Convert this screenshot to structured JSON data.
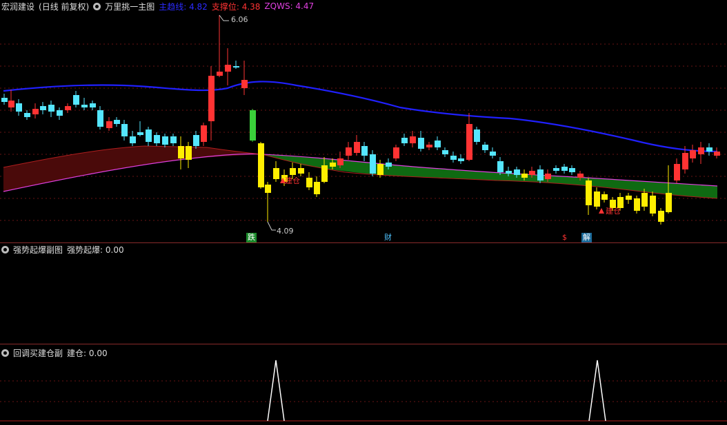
{
  "main_panel": {
    "stock_name": "宏润建设",
    "period_label": "(日线 前复权)",
    "indicator_name": "万里挑一主图",
    "line1": {
      "label": "主趋线",
      "value": "4.82",
      "color": "#2b2bff"
    },
    "line2": {
      "label": "支撑位",
      "value": "4.38",
      "color": "#ff3333"
    },
    "line3": {
      "label": "ZQWS",
      "value": "4.47",
      "color": "#e040e0"
    },
    "high_label": "6.06",
    "low_label": "4.09",
    "markers": [
      {
        "text": "跌",
        "color": "#ffffff",
        "bg": "#1b8a2b"
      },
      {
        "text": "财",
        "color": "#4fc3ff",
        "bg": "#000000"
      },
      {
        "text": "$",
        "color": "#ff3333",
        "bg": "#000000"
      },
      {
        "text": "解",
        "color": "#ffffff",
        "bg": "#1a6a9a"
      }
    ],
    "jiancang_label_1": "建仓",
    "jiancang_label_2": "建仓"
  },
  "sub1": {
    "indicator_name": "强势起爆副图",
    "value_label": "强势起爆",
    "value": "0.00"
  },
  "sub2": {
    "indicator_name": "回调买建仓副",
    "value_label": "建仓",
    "value": "0.00",
    "spikes": [
      1,
      1
    ]
  },
  "chart_data": {
    "type": "candlestick",
    "price_range": [
      4.09,
      6.06
    ],
    "lines": [
      {
        "name": "主趋线",
        "last": 4.82
      },
      {
        "name": "支撑位",
        "last": 4.38
      },
      {
        "name": "ZQWS",
        "last": 4.47
      }
    ]
  }
}
